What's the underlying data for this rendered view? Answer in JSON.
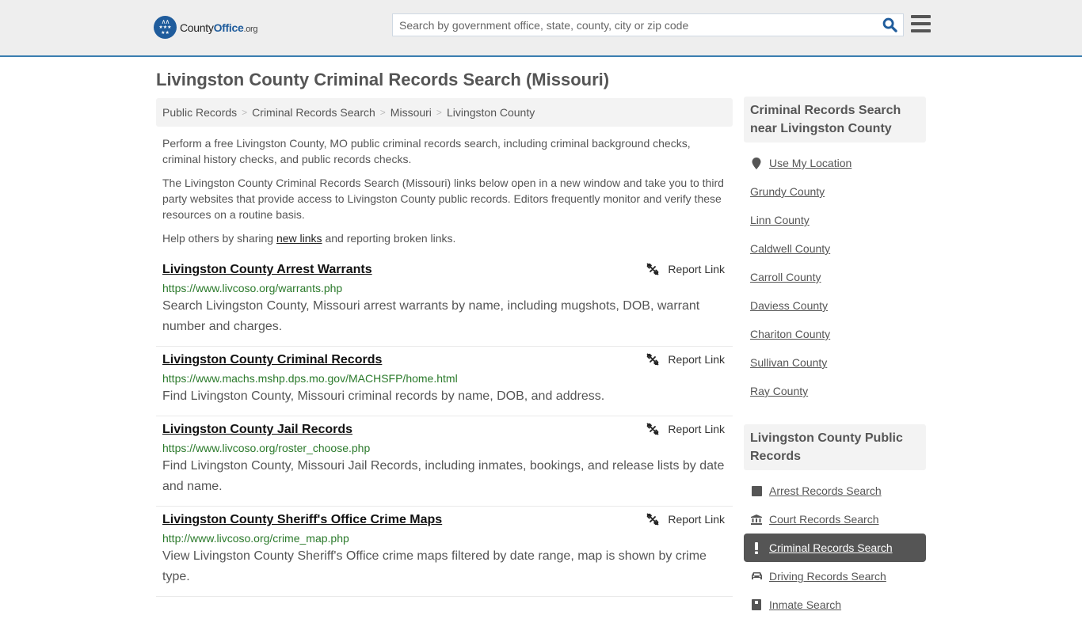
{
  "header": {
    "logo": {
      "word1": "County",
      "word2": "Office",
      "suffix": ".org"
    },
    "search": {
      "placeholder": "Search by government office, state, county, city or zip code",
      "value": ""
    },
    "icons": {
      "search": "search-icon",
      "menu": "hamburger-menu-icon"
    }
  },
  "page": {
    "title": "Livingston County Criminal Records Search (Missouri)",
    "breadcrumb": [
      "Public Records",
      "Criminal Records Search",
      "Missouri",
      "Livingston County"
    ],
    "intro": {
      "p1": "Perform a free Livingston County, MO public criminal records search, including criminal background checks, criminal history checks, and public records checks.",
      "p2": "The Livingston County Criminal Records Search (Missouri) links below open in a new window and take you to third party websites that provide access to Livingston County public records. Editors frequently monitor and verify these resources on a routine basis.",
      "p3_before": "Help others by sharing ",
      "p3_link": "new links",
      "p3_after": " and reporting broken links."
    },
    "report_label": "Report Link",
    "results": [
      {
        "title": "Livingston County Arrest Warrants",
        "url": "https://www.livcoso.org/warrants.php",
        "description": "Search Livingston County, Missouri arrest warrants by name, including mugshots, DOB, warrant number and charges."
      },
      {
        "title": "Livingston County Criminal Records",
        "url": "https://www.machs.mshp.dps.mo.gov/MACHSFP/home.html",
        "description": "Find Livingston County, Missouri criminal records by name, DOB, and address."
      },
      {
        "title": "Livingston County Jail Records",
        "url": "https://www.livcoso.org/roster_choose.php",
        "description": "Find Livingston County, Missouri Jail Records, including inmates, bookings, and release lists by date and name."
      },
      {
        "title": "Livingston County Sheriff's Office Crime Maps",
        "url": "http://www.livcoso.org/crime_map.php",
        "description": "View Livingston County Sheriff's Office crime maps filtered by date range, map is shown by crime type."
      }
    ]
  },
  "sidebar": {
    "nearby": {
      "heading": "Criminal Records Search near Livingston County",
      "use_location": "Use My Location",
      "counties": [
        "Grundy County",
        "Linn County",
        "Caldwell County",
        "Carroll County",
        "Daviess County",
        "Chariton County",
        "Sullivan County",
        "Ray County"
      ]
    },
    "public_records": {
      "heading": "Livingston County Public Records",
      "items": [
        {
          "label": "Arrest Records Search",
          "icon": "square-icon",
          "active": false
        },
        {
          "label": "Court Records Search",
          "icon": "courthouse-icon",
          "active": false
        },
        {
          "label": "Criminal Records Search",
          "icon": "exclamation-icon",
          "active": true
        },
        {
          "label": "Driving Records Search",
          "icon": "car-icon",
          "active": false
        },
        {
          "label": "Inmate Search",
          "icon": "id-card-icon",
          "active": false
        }
      ]
    }
  },
  "colors": {
    "brand_blue": "#1f5c9c",
    "header_border": "#3a7eb0",
    "url_green": "#2b7a2b",
    "active_item_bg": "#555555"
  }
}
